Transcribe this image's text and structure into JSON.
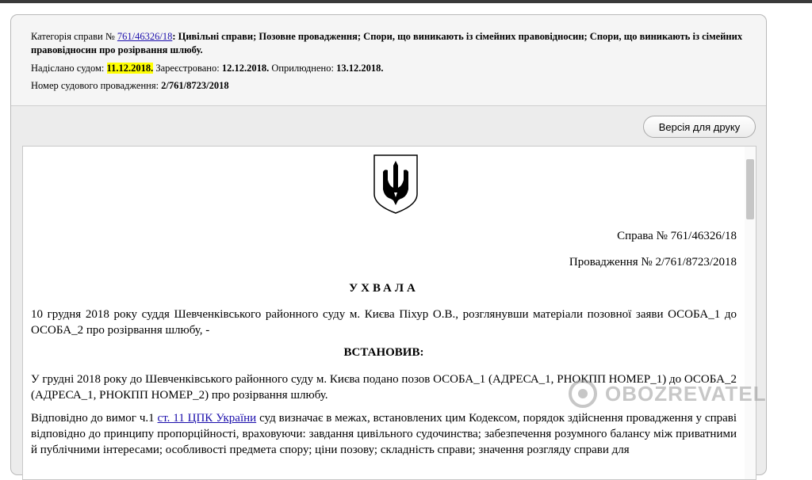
{
  "meta": {
    "category_prefix": "Категорія справи №",
    "case_link": "761/46326/18",
    "category_text": ": Цивільні справи; Позовне провадження; Спори, що виникають із сімейних правовідносин; Спори, що виникають із сімейних правовідносин про розірвання шлюбу.",
    "sent_label": "Надіслано судом:",
    "sent_date": "11.12.2018.",
    "registered_label": "Зареєстровано:",
    "registered_date": "12.12.2018.",
    "published_label": "Оприлюднено:",
    "published_date": "13.12.2018.",
    "proceeding_label": "Номер судового провадження:",
    "proceeding_number": "2/761/8723/2018"
  },
  "toolbar": {
    "print_label": "Версія для друку"
  },
  "document": {
    "case_line": "Справа № 761/46326/18",
    "proceeding_line": "Провадження № 2/761/8723/2018",
    "title": "УХВАЛА",
    "intro": "10 грудня 2018 року суддя Шевченківського районного суду м. Києва Піхур О.В., розглянувши матеріали позовної заяви ОСОБА_1 до ОСОБА_2 про розірвання шлюбу, -",
    "established": "ВСТАНОВИВ:",
    "para1": "У грудні 2018 року до Шевченківського районного суду м. Києва подано позов ОСОБА_1 (АДРЕСА_1, РНОКПП НОМЕР_1) до ОСОБА_2 (АДРЕСА_1, РНОКПП НОМЕР_2) про розірвання шлюбу.",
    "para2_start": "Відповідно до вимог ч.1 ",
    "para2_link": "ст. 11 ЦПК України",
    "para2_rest": " суд визначає в межах, встановлених цим Кодексом, порядок здійснення провадження у справі відповідно до принципу пропорційності, враховуючи: завдання цивільного судочинства; забезпечення розумного балансу між приватними й публічними інтересами; особливості предмета спору; ціни позову; складність справи; значення розгляду справи для"
  },
  "watermark": {
    "text": "OBOZREVATEL"
  },
  "colors": {
    "highlight": "#ffff00",
    "link": "#1a0dab",
    "panel": "#ececec"
  }
}
